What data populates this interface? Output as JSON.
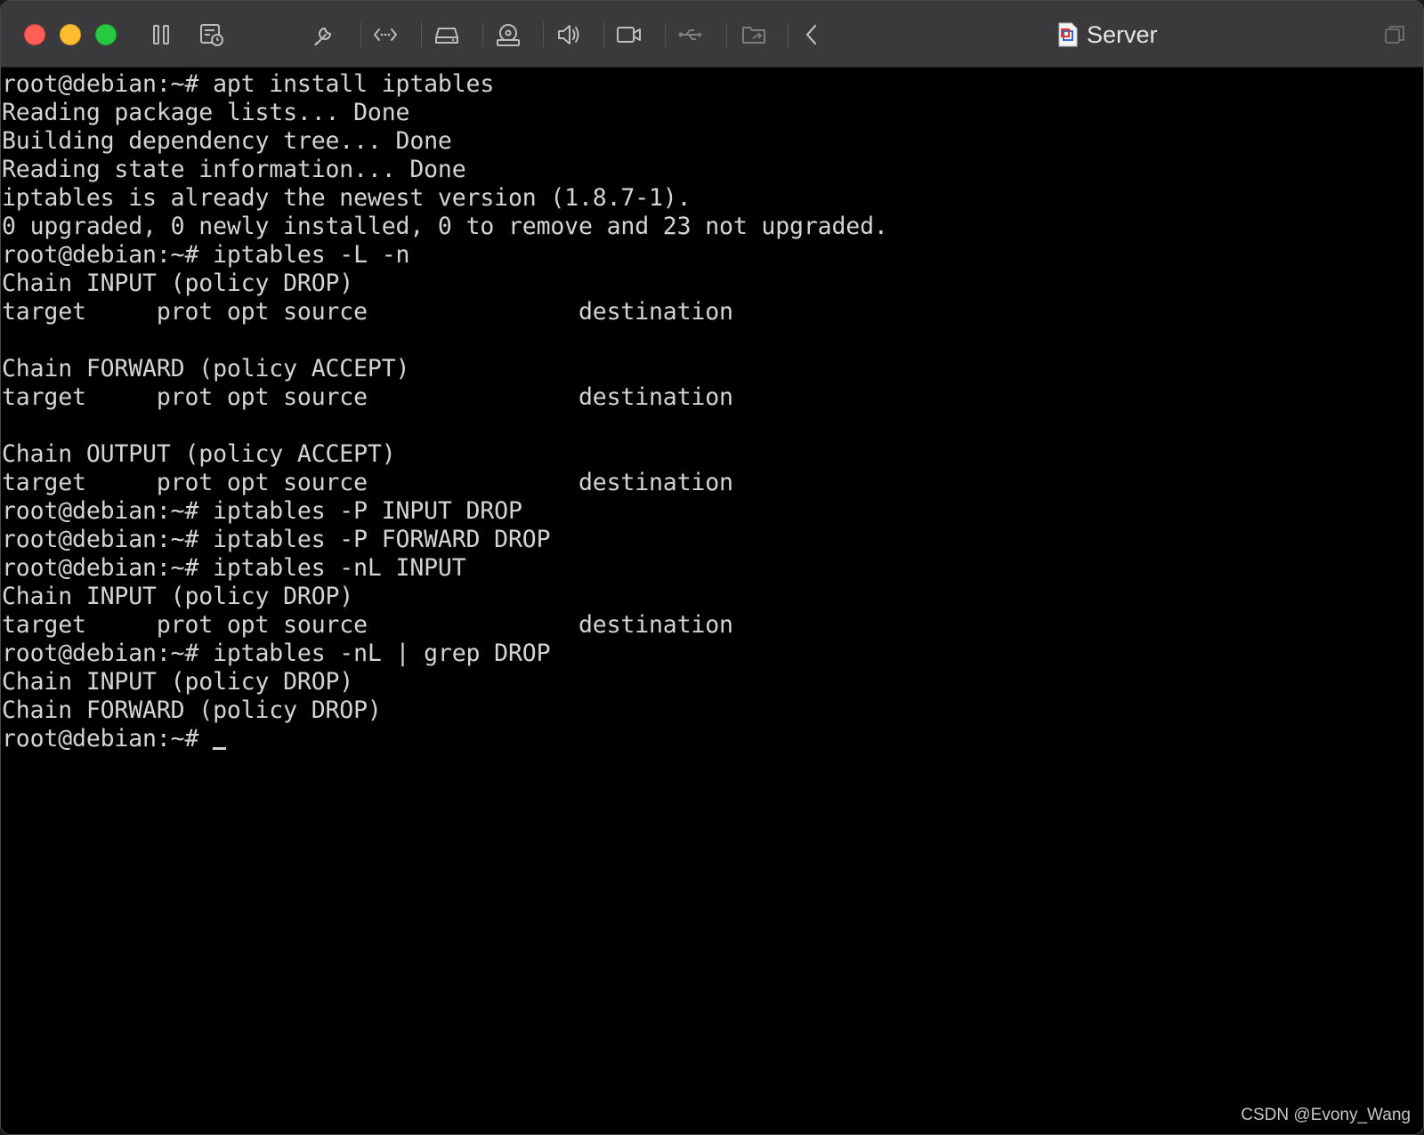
{
  "window": {
    "title": "Server",
    "title_icon": "vm-document-icon"
  },
  "toolbar": {
    "icons": [
      "pause-icon",
      "snapshot-icon",
      "settings-wrench-icon",
      "network-icon",
      "hard-disk-icon",
      "cd-drive-icon",
      "sound-icon",
      "camera-icon",
      "usb-icon",
      "shared-folder-icon",
      "collapse-chevron-left-icon"
    ]
  },
  "terminal": {
    "lines": [
      "root@debian:~# apt install iptables",
      "Reading package lists... Done",
      "Building dependency tree... Done",
      "Reading state information... Done",
      "iptables is already the newest version (1.8.7-1).",
      "0 upgraded, 0 newly installed, 0 to remove and 23 not upgraded.",
      "root@debian:~# iptables -L -n",
      "Chain INPUT (policy DROP)",
      "target     prot opt source               destination",
      "",
      "Chain FORWARD (policy ACCEPT)",
      "target     prot opt source               destination",
      "",
      "Chain OUTPUT (policy ACCEPT)",
      "target     prot opt source               destination",
      "root@debian:~# iptables -P INPUT DROP",
      "root@debian:~# iptables -P FORWARD DROP",
      "root@debian:~# iptables -nL INPUT",
      "Chain INPUT (policy DROP)",
      "target     prot opt source               destination",
      "root@debian:~# iptables -nL | grep DROP",
      "Chain INPUT (policy DROP)",
      "Chain FORWARD (policy DROP)"
    ],
    "prompt": "root@debian:~# "
  },
  "watermark": "CSDN @Evony_Wang",
  "colors": {
    "titlebar": "#3a3a3c",
    "terminal_bg": "#000000",
    "terminal_fg": "#d4d4d4",
    "close": "#ff5f57",
    "minimize": "#febc2e",
    "zoom": "#28c840"
  }
}
